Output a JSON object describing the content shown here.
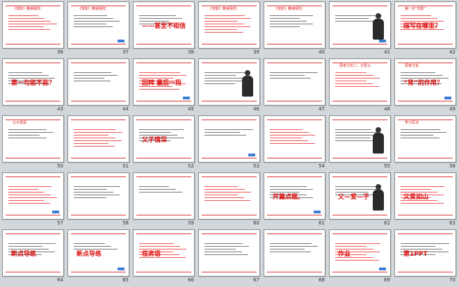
{
  "slides": [
    {
      "number": "36",
      "title": "《背影》精读探究：",
      "highlight": ""
    },
    {
      "number": "37",
      "title": "《背影》精读探究：",
      "highlight": ""
    },
    {
      "number": "38",
      "title": "",
      "highlight": "——甚至不相信"
    },
    {
      "number": "39",
      "title": "《背影》精读探究：",
      "highlight": ""
    },
    {
      "number": "40",
      "title": "《背影》精读探究：",
      "highlight": ""
    },
    {
      "number": "41",
      "title": "",
      "highlight": ""
    },
    {
      "number": "42",
      "title": "第一次“背影”",
      "highlight": "描写在哪里？"
    },
    {
      "number": "43",
      "title": "",
      "highlight": "第一句能不能？"
    },
    {
      "number": "44",
      "title": "",
      "highlight": ""
    },
    {
      "number": "45",
      "title": "",
      "highlight": "回转 最后一段"
    },
    {
      "number": "46",
      "title": "",
      "highlight": ""
    },
    {
      "number": "47",
      "title": "",
      "highlight": ""
    },
    {
      "number": "48",
      "title": "思考讨论二：子爱父",
      "highlight": ""
    },
    {
      "number": "49",
      "title": "思考讨论",
      "highlight": "“背”的作用？"
    },
    {
      "number": "50",
      "title": "父子情深",
      "highlight": ""
    },
    {
      "number": "51",
      "title": "",
      "highlight": ""
    },
    {
      "number": "52",
      "title": "",
      "highlight": "父子情深"
    },
    {
      "number": "53",
      "title": "",
      "highlight": ""
    },
    {
      "number": "54",
      "title": "",
      "highlight": ""
    },
    {
      "number": "55",
      "title": "",
      "highlight": ""
    },
    {
      "number": "56",
      "title": "学习写法",
      "highlight": ""
    },
    {
      "number": "57",
      "title": "",
      "highlight": ""
    },
    {
      "number": "58",
      "title": "",
      "highlight": ""
    },
    {
      "number": "59",
      "title": "",
      "highlight": ""
    },
    {
      "number": "60",
      "title": "",
      "highlight": ""
    },
    {
      "number": "61",
      "title": "",
      "highlight": "开篇点题。"
    },
    {
      "number": "62",
      "title": "",
      "highlight": "父—爱—子"
    },
    {
      "number": "63",
      "title": "",
      "highlight": "父爱如山"
    },
    {
      "number": "64",
      "title": "",
      "highlight": "新点导练"
    },
    {
      "number": "65",
      "title": "",
      "highlight": "新点导练"
    },
    {
      "number": "66",
      "title": "",
      "highlight": "任务语"
    },
    {
      "number": "67",
      "title": "",
      "highlight": ""
    },
    {
      "number": "68",
      "title": "",
      "highlight": ""
    },
    {
      "number": "69",
      "title": "",
      "highlight": "作业"
    },
    {
      "number": "70",
      "title": "",
      "highlight": "第1PPT"
    }
  ]
}
